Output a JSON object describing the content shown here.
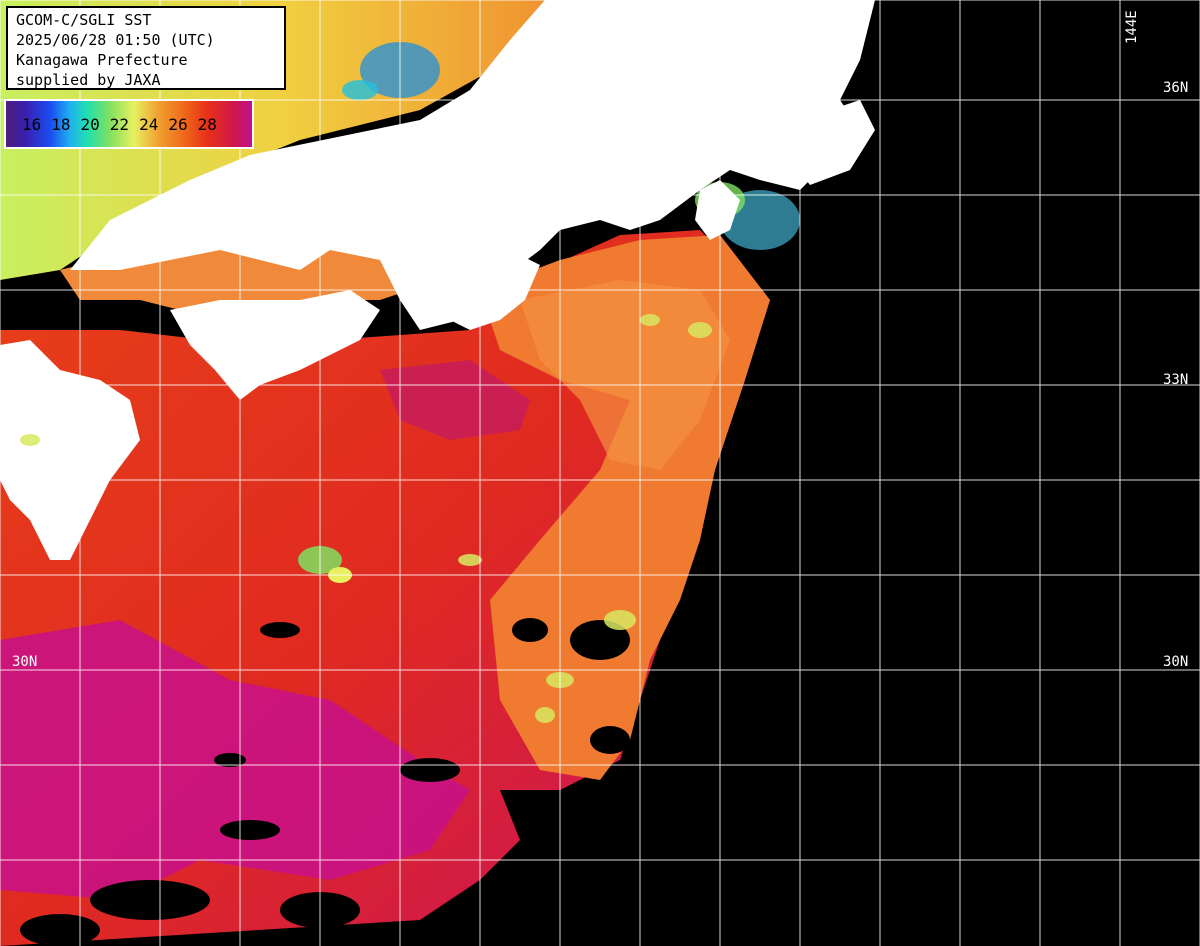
{
  "title_box": {
    "line1": "GCOM-C/SGLI SST",
    "line2": "2025/06/28 01:50 (UTC)",
    "line3": "Kanagawa Prefecture",
    "line4": "supplied by JAXA"
  },
  "color_scale": {
    "labels": [
      "16",
      "18",
      "20",
      "22",
      "24",
      "26",
      "28"
    ],
    "colors": [
      "#3a1fb0",
      "#1fb0f0",
      "#20e0b0",
      "#e8f060",
      "#f06a1a",
      "#e83018",
      "#c01090"
    ]
  },
  "grid_labels": {
    "lat": {
      "36N": "36N",
      "33N": "33N",
      "30N_right": "30N",
      "30N_left": "30N"
    },
    "lon": {
      "144E": "144E"
    }
  },
  "colors": {
    "land": "#ffffff",
    "no_data": "#000000",
    "grid": "#ffffff",
    "warm": "#e83018",
    "hot": "#c01090",
    "orange": "#f07a30",
    "cool": "#e8f060",
    "cold": "#20c0e0"
  }
}
